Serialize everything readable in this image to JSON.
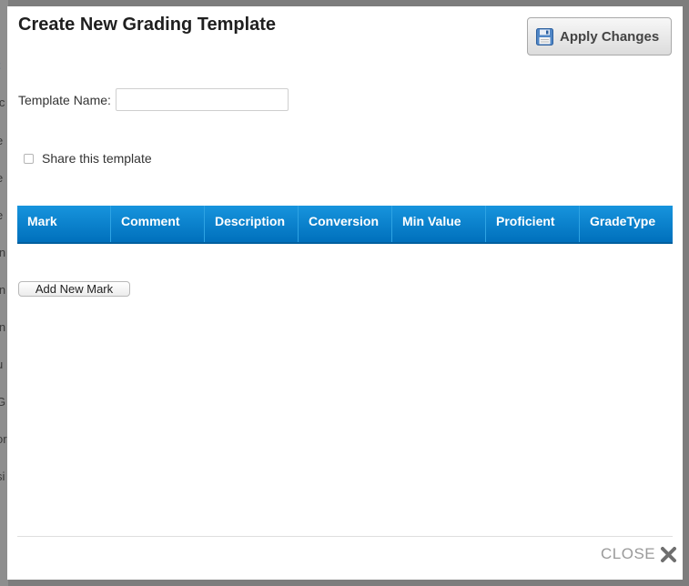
{
  "background": {
    "fragments": [
      "t",
      "ic",
      "e",
      "e",
      "e",
      "in",
      "in",
      "in",
      "u",
      "G",
      "or",
      "si"
    ]
  },
  "modal": {
    "title": "Create New Grading Template",
    "apply_button": {
      "label": "Apply Changes",
      "icon": "floppy-disk-save-icon"
    },
    "template_name": {
      "label": "Template Name:",
      "value": "",
      "placeholder": ""
    },
    "share": {
      "label": "Share this template",
      "checked": false
    },
    "grid": {
      "columns": [
        "Mark",
        "Comment",
        "Description",
        "Conversion",
        "Min Value",
        "Proficient",
        "GradeType"
      ],
      "rows": []
    },
    "add_mark_button": {
      "label": "Add New Mark"
    },
    "close": {
      "label": "CLOSE",
      "icon": "close-x-icon"
    }
  },
  "colors": {
    "grid_header": "#0a82cc",
    "overlay": "#7d7d7d"
  }
}
